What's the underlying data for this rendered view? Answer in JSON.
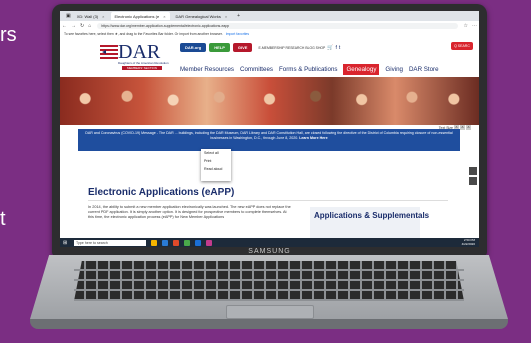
{
  "background_fragments": {
    "top": "rs",
    "bottom": "t"
  },
  "laptop": {
    "brand": "SAMSUNG"
  },
  "browser": {
    "tabs": [
      {
        "label": "XD: Wall (3)",
        "active": false
      },
      {
        "label": "Electronic Applications (e",
        "active": true
      },
      {
        "label": "DAR Genealogical Works",
        "active": false
      }
    ],
    "new_tab": "+",
    "url": "https://www.dar.org/member-application-supplemental/electronic-applications-eapp",
    "favbar_text": "To see favorites here, select",
    "favbar_hint": "then ★, and drag to the Favorites Bar folder. Or import from another browser.",
    "favbar_link": "Import favorites"
  },
  "site": {
    "logo": {
      "word": "DAR",
      "subtitle": "Daughters of the American Revolution",
      "member": "MEMBERS' SECTION"
    },
    "top_buttons": [
      {
        "label": "DAR.org",
        "color": "#1a4a94"
      },
      {
        "label": "HELP",
        "color": "#3a9a3a"
      },
      {
        "label": "GIVE",
        "color": "#b5182b"
      }
    ],
    "top_links": "E-MEMBERSHIP  RESEARCH  BLOG  SHOP",
    "search_label": "Q SEARC",
    "nav": [
      {
        "label": "Member Resources",
        "active": false
      },
      {
        "label": "Committees",
        "active": false
      },
      {
        "label": "Forms & Publications",
        "active": false
      },
      {
        "label": "Genealogy",
        "active": true
      },
      {
        "label": "Giving",
        "active": false
      },
      {
        "label": "DAR Store",
        "active": false
      }
    ],
    "text_size": "Text Size",
    "text_size_buttons": [
      "A",
      "A",
      "A"
    ],
    "notice": "DAR and Coronavirus (COVID-19) Message - The DAR ... buildings, including the DAR Museum, DAR Library and DAR Constitution Hall, are closed following the directive of the District of Columbia requiring closure of non-essential businesses in Washington, D.C., through June 8, 2020.",
    "notice_link": "Learn More Here",
    "context_menu": [
      "Select all",
      "Print",
      "Read aloud"
    ],
    "heading": "Electronic Applications (eAPP)",
    "body": "In 2014, the ability to submit a new member application electronically was launched. The new eAPP does not replace the current PDF application. It is simply another option. It is designed for prospective members to complete themselves. At this time, the electronic application process (eAPP) for New Member Applications",
    "sidebox_title": "Applications & Supplementals"
  },
  "taskbar": {
    "search_placeholder": "Type here to search",
    "icon_colors": [
      "#f5b400",
      "#2a7ad5",
      "#e04a2a",
      "#4aa84a",
      "#1a6fd8",
      "#c43b8d"
    ],
    "time": "2:50 PM",
    "date": "4/22/2020"
  }
}
